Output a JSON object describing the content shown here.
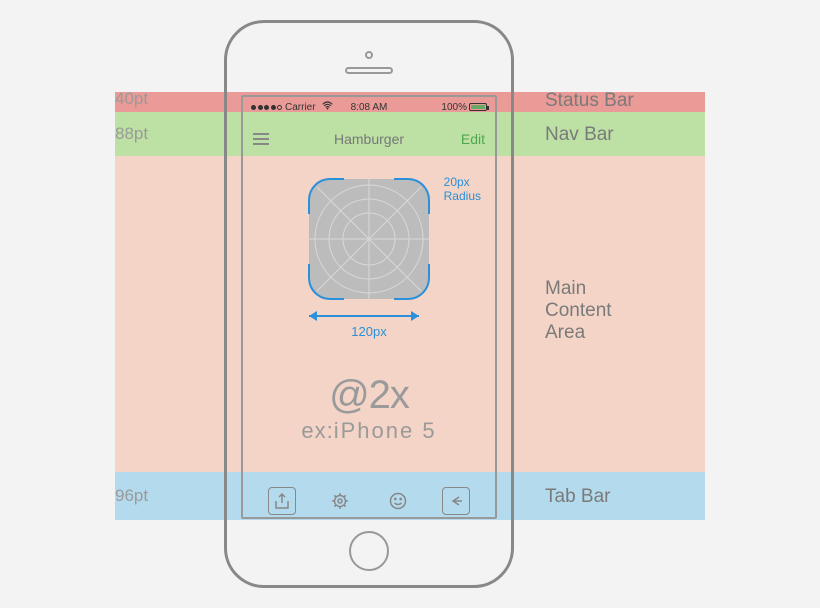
{
  "bands": {
    "status": {
      "label": "Status Bar",
      "pt": "40pt"
    },
    "nav": {
      "label": "Nav Bar",
      "pt": "88pt"
    },
    "main": {
      "label": "Main\nContent\nArea"
    },
    "tab": {
      "label": "Tab Bar",
      "pt": "96pt"
    }
  },
  "status": {
    "carrier": "Carrier",
    "time": "8:08 AM",
    "battery_pct": "100%"
  },
  "nav": {
    "title": "Hamburger",
    "edit": "Edit"
  },
  "icon": {
    "radius_label": "20px\nRadius",
    "width_label": "120px"
  },
  "resolution": {
    "scale": "@2x",
    "example_prefix": "ex:",
    "example_device": "iPhone 5"
  }
}
